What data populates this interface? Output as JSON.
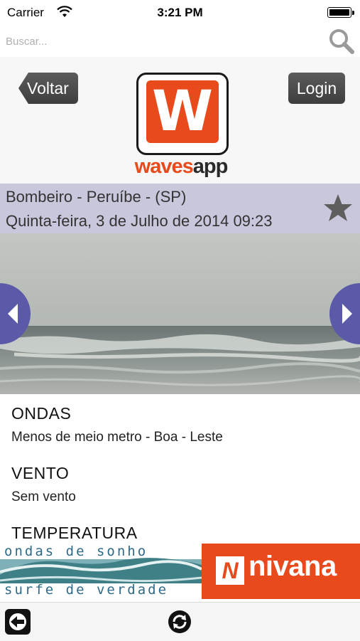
{
  "status_bar": {
    "carrier": "Carrier",
    "time": "3:21 PM"
  },
  "search": {
    "placeholder": "Buscar..."
  },
  "header": {
    "back_label": "Voltar",
    "login_label": "Login",
    "brand_waves": "waves",
    "brand_app": "app",
    "logo_letter": "W"
  },
  "spot": {
    "name": "Bombeiro - Peruíbe - (SP)",
    "datetime": "Quinta-feira, 3 de Julho de 2014 09:23"
  },
  "details": {
    "sections": [
      {
        "title": "ONDAS",
        "value": "Menos de meio metro - Boa - Leste"
      },
      {
        "title": "VENTO",
        "value": "Sem vento"
      },
      {
        "title": "TEMPERATURA",
        "value": ""
      }
    ]
  },
  "ad": {
    "line1": "ondas de sonho",
    "line2": "surfe de verdade",
    "brand": "nivana",
    "brand_mark": "N"
  },
  "colors": {
    "brand": "#e84a1c",
    "spot_bar": "#c9c7dc",
    "arrow": "#5a5aa8"
  }
}
